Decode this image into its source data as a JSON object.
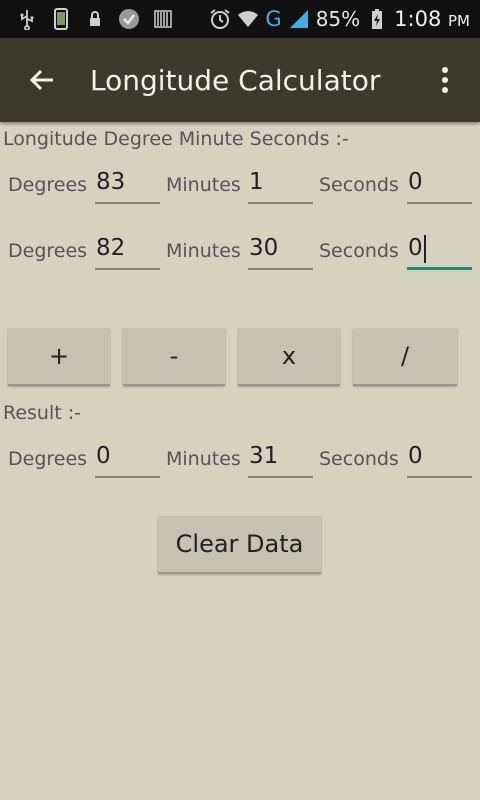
{
  "status_bar": {
    "battery": "85%",
    "time": "1:08",
    "ampm": "PM",
    "network": "G",
    "icons": [
      "usb-icon",
      "phone-icon",
      "lock-icon",
      "check-icon",
      "barcode-icon",
      "alarm-icon",
      "wifi-icon",
      "signal-icon",
      "battery-icon"
    ]
  },
  "toolbar": {
    "title": "Longitude Calculator",
    "background": "#3c3a2c"
  },
  "input_section": {
    "label": "Longitude Degree Minute Seconds :-",
    "row1": {
      "degrees_label": "Degrees",
      "degrees": "83",
      "minutes_label": "Minutes",
      "minutes": "1",
      "seconds_label": "Seconds",
      "seconds": "0"
    },
    "row2": {
      "degrees_label": "Degrees",
      "degrees": "82",
      "minutes_label": "Minutes",
      "minutes": "30",
      "seconds_label": "Seconds",
      "seconds": "0"
    }
  },
  "operations": {
    "add": "+",
    "subtract": "-",
    "multiply": "x",
    "divide": "/"
  },
  "result_section": {
    "label": "Result :-",
    "degrees_label": "Degrees",
    "degrees": "0",
    "minutes_label": "Minutes",
    "minutes": "31",
    "seconds_label": "Seconds",
    "seconds": "0"
  },
  "clear_button": "Clear Data",
  "colors": {
    "accent": "#1e8c6f",
    "background": "#d6d2c0",
    "button": "#c5c2b2"
  }
}
